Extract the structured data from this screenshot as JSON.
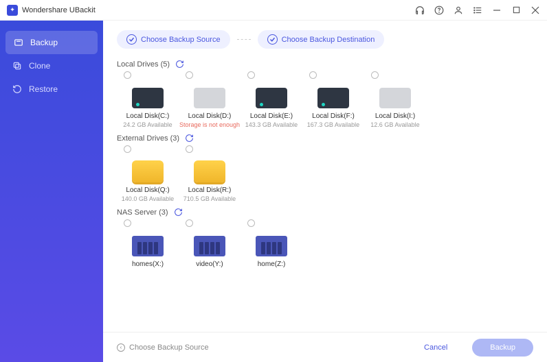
{
  "app": {
    "title": "Wondershare UBackit"
  },
  "sidebar": {
    "items": [
      {
        "label": "Backup"
      },
      {
        "label": "Clone"
      },
      {
        "label": "Restore"
      }
    ]
  },
  "steps": {
    "source": "Choose Backup Source",
    "destination": "Choose Backup Destination"
  },
  "sections": {
    "local": {
      "title": "Local Drives (5)"
    },
    "external": {
      "title": "External Drives (3)"
    },
    "nas": {
      "title": "NAS Server (3)"
    }
  },
  "local_drives": [
    {
      "label": "Local Disk(C:)",
      "sub": "24.2 GB Available"
    },
    {
      "label": "Local Disk(D:)",
      "sub": "Storage is not enough"
    },
    {
      "label": "Local Disk(E:)",
      "sub": "143.3 GB Available"
    },
    {
      "label": "Local Disk(F:)",
      "sub": "167.3 GB Available"
    },
    {
      "label": "Local Disk(I:)",
      "sub": "12.6 GB Available"
    }
  ],
  "external_drives": [
    {
      "label": "Local Disk(Q:)",
      "sub": "140.0 GB Available"
    },
    {
      "label": "Local Disk(R:)",
      "sub": "710.5 GB Available"
    }
  ],
  "nas_servers": [
    {
      "label": "homes(X:)"
    },
    {
      "label": "video(Y:)"
    },
    {
      "label": "home(Z:)"
    }
  ],
  "footer": {
    "hint": "Choose Backup Source",
    "cancel": "Cancel",
    "primary": "Backup"
  }
}
